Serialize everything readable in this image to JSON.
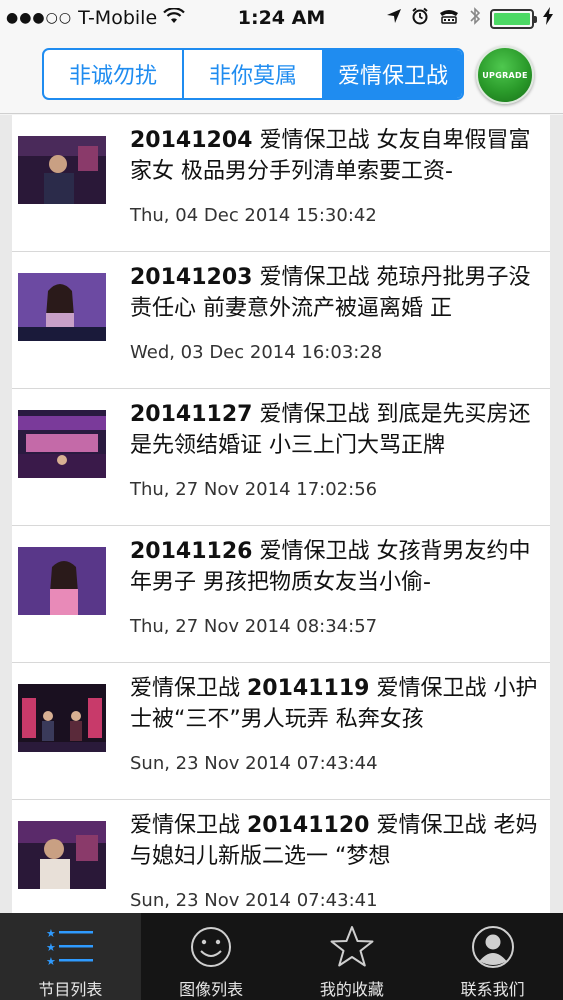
{
  "status_bar": {
    "carrier": "T-Mobile",
    "signal_dots": "●●●○○",
    "time": "1:24 AM"
  },
  "header": {
    "segments": [
      {
        "label": "非诚勿扰",
        "active": false
      },
      {
        "label": "非你莫属",
        "active": false
      },
      {
        "label": "爱情保卫战",
        "active": true
      }
    ],
    "upgrade_label": "UPGRADE"
  },
  "list": {
    "items": [
      {
        "title_bold": "20141204",
        "title": " 爱情保卫战 女友自卑假冒富家女 极品男分手列清单索要工资-",
        "date": "Thu, 04 Dec 2014 15:30:42"
      },
      {
        "title_bold": "20141203",
        "title": " 爱情保卫战 苑琼丹批男子没责任心 前妻意外流产被逼离婚 正",
        "date": "Wed, 03 Dec 2014 16:03:28"
      },
      {
        "title_bold": "20141127",
        "title": " 爱情保卫战 到底是先买房还是先领结婚证 小三上门大骂正牌",
        "date": "Thu, 27 Nov 2014 17:02:56"
      },
      {
        "title_bold": "20141126",
        "title": " 爱情保卫战 女孩背男友约中年男子 男孩把物质女友当小偷-",
        "date": "Thu, 27 Nov 2014 08:34:57"
      },
      {
        "title_prefix": "爱情保卫战 ",
        "title_bold": "20141119",
        "title": " 爱情保卫战 小护士被“三不”男人玩弄 私奔女孩",
        "date": "Sun, 23 Nov 2014 07:43:44"
      },
      {
        "title_prefix": "爱情保卫战 ",
        "title_bold": "20141120",
        "title": " 爱情保卫战 老妈与媳妇儿新版二选一 “梦想",
        "date": "Sun, 23 Nov 2014 07:43:41"
      }
    ]
  },
  "tabbar": {
    "tabs": [
      {
        "label": "节目列表",
        "icon": "list-icon",
        "active": true
      },
      {
        "label": "图像列表",
        "icon": "smiley-icon",
        "active": false
      },
      {
        "label": "我的收藏",
        "icon": "star-icon",
        "active": false
      },
      {
        "label": "联系我们",
        "icon": "person-icon",
        "active": false
      }
    ]
  },
  "colors": {
    "accent": "#1f8cf0",
    "upgrade_green": "#2a9a2a",
    "battery_green": "#4cd964",
    "tabbar_bg": "#151515"
  }
}
